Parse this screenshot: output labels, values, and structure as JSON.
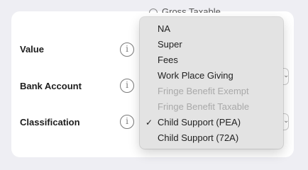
{
  "background_option": {
    "label": "Gross Taxable"
  },
  "rows": [
    {
      "label": "Value"
    },
    {
      "label": "Bank Account"
    },
    {
      "label": "Classification"
    }
  ],
  "info_icon_glyph": "i",
  "dropdown": {
    "items": [
      {
        "label": "NA",
        "enabled": true,
        "checked": false
      },
      {
        "label": "Super",
        "enabled": true,
        "checked": false
      },
      {
        "label": "Fees",
        "enabled": true,
        "checked": false
      },
      {
        "label": "Work Place Giving",
        "enabled": true,
        "checked": false
      },
      {
        "label": "Fringe Benefit Exempt",
        "enabled": false,
        "checked": false
      },
      {
        "label": "Fringe Benefit Taxable",
        "enabled": false,
        "checked": false
      },
      {
        "label": "Child Support (PEA)",
        "enabled": true,
        "checked": true
      },
      {
        "label": "Child Support (72A)",
        "enabled": true,
        "checked": false
      }
    ],
    "check_glyph": "✓"
  },
  "colors": {
    "page_background": "#eeeef3",
    "card_background": "#ffffff",
    "menu_background": "#e3e3e3",
    "disabled_text": "#a9a9a9"
  }
}
